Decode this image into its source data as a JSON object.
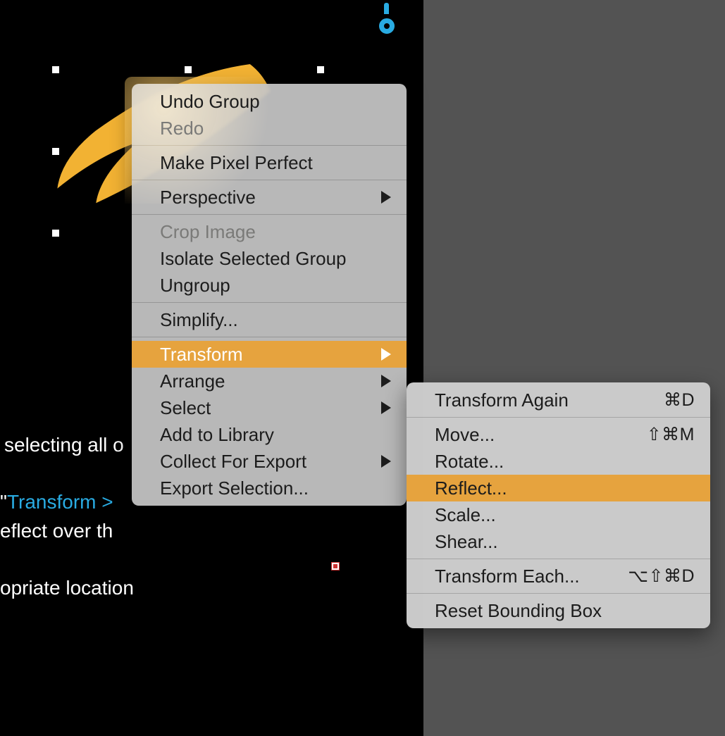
{
  "canvas": {
    "shape_color": "#F2B233"
  },
  "bg_text": {
    "line1": "selecting all o",
    "line2_prefix": "\"",
    "line2_link": "Transform >",
    "line3": "eflect over th",
    "line4": "opriate location"
  },
  "main_menu": {
    "undo": "Undo Group",
    "redo": "Redo",
    "pixel_perfect": "Make Pixel Perfect",
    "perspective": "Perspective",
    "crop": "Crop Image",
    "isolate": "Isolate Selected Group",
    "ungroup": "Ungroup",
    "simplify": "Simplify...",
    "transform": "Transform",
    "arrange": "Arrange",
    "select": "Select",
    "add_library": "Add to Library",
    "collect_export": "Collect For Export",
    "export_selection": "Export Selection..."
  },
  "sub_menu": {
    "transform_again": "Transform Again",
    "transform_again_key": "⌘D",
    "move": "Move...",
    "move_key": "⇧⌘M",
    "rotate": "Rotate...",
    "reflect": "Reflect...",
    "scale": "Scale...",
    "shear": "Shear...",
    "transform_each": "Transform Each...",
    "transform_each_key": "⌥⇧⌘D",
    "reset_bbox": "Reset Bounding Box"
  }
}
